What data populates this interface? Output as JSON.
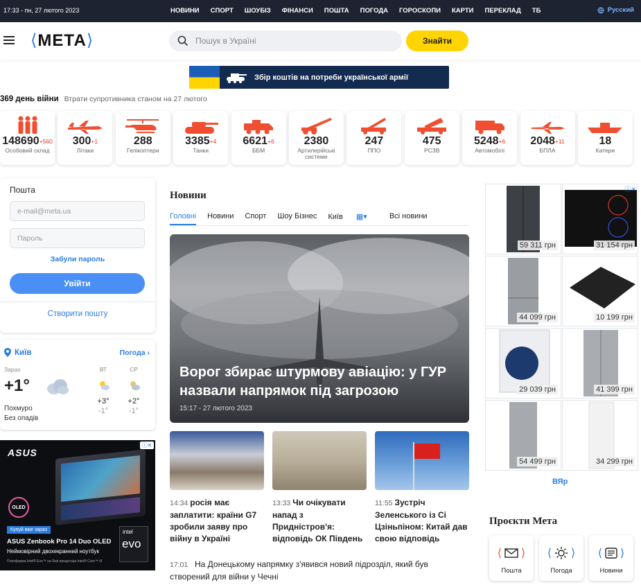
{
  "topbar": {
    "datetime": "17:33 - пн, 27 лютого 2023",
    "nav": [
      "НОВИНИ",
      "СПОРТ",
      "ШОУБІЗ",
      "ФІНАНСИ",
      "ПОШТА",
      "ПОГОДА",
      "ГОРОСКОПИ",
      "КАРТИ",
      "ПЕРЕКЛАД",
      "ТБ"
    ],
    "lang": "Русский"
  },
  "header": {
    "logo": "МЕТА",
    "search_placeholder": "Пошук в Україні",
    "find_label": "Знайти"
  },
  "banner": {
    "text": "Збір коштів на потреби української армії"
  },
  "war": {
    "day_label": "369 день війни",
    "losses_label": "Втрати супротивника станом на 27 лютого",
    "stats": [
      {
        "icon": "soldiers-icon",
        "value": "148690",
        "delta": "+560",
        "label": "Особовий склад"
      },
      {
        "icon": "plane-icon",
        "value": "300",
        "delta": "+1",
        "label": "Літаки"
      },
      {
        "icon": "helicopter-icon",
        "value": "288",
        "delta": "",
        "label": "Гелікоптери"
      },
      {
        "icon": "tank-icon",
        "value": "3385",
        "delta": "+4",
        "label": "Танки"
      },
      {
        "icon": "bmp-icon",
        "value": "6621",
        "delta": "+6",
        "label": "ББМ"
      },
      {
        "icon": "artillery-icon",
        "value": "2380",
        "delta": "",
        "label": "Артилерійські системи"
      },
      {
        "icon": "air-defense-icon",
        "value": "247",
        "delta": "",
        "label": "ППО"
      },
      {
        "icon": "mlrs-icon",
        "value": "475",
        "delta": "",
        "label": "РСЗВ"
      },
      {
        "icon": "truck-icon",
        "value": "5248",
        "delta": "+6",
        "label": "Автомобілі"
      },
      {
        "icon": "drone-icon",
        "value": "2048",
        "delta": "+11",
        "label": "БПЛА"
      },
      {
        "icon": "boat-icon",
        "value": "18",
        "delta": "",
        "label": "Катери"
      }
    ]
  },
  "login": {
    "title": "Пошта",
    "email_placeholder": "e-mail@meta.ua",
    "password_placeholder": "Пароль",
    "forgot": "Забули пароль",
    "submit": "Увійти",
    "create": "Створити пошту"
  },
  "weather": {
    "city": "Київ",
    "forecast_link": "Погода",
    "now_label": "Зараз",
    "now_temp": "+1°",
    "desc1": "Похмуро",
    "desc2": "Без опадів",
    "days": [
      {
        "name": "ВТ",
        "hi": "+3°",
        "lo": "-1°"
      },
      {
        "name": "СР",
        "hi": "+2°",
        "lo": "-1°"
      }
    ]
  },
  "asus_ad": {
    "brand": "ASUS",
    "badge": "Купуй вже зараз",
    "model": "ASUS Zenbook Pro 14 Duo OLED",
    "tagline": "Неймовірний двохекранний ноутбук",
    "platform": "Платформа Intel® Evo™ на базі процесора Intel® Core™ i9",
    "oled": "OLED",
    "intel": "intel",
    "evo": "evo"
  },
  "news": {
    "title": "Новини",
    "tabs": [
      "Головні",
      "Новини",
      "Спорт",
      "Шоу Бізнес",
      "Київ",
      "Всі новини"
    ],
    "hero": {
      "title": "Ворог збирає штурмову авіацію: у ГУР назвали напрямок під загрозою",
      "date": "15:17 - 27 лютого 2023"
    },
    "cards": [
      {
        "time": "14:34",
        "title": "росія має заплатити: країни G7 зробили заяву про війну в Україні"
      },
      {
        "time": "13:33",
        "title": "Чи очікувати напад з Придністров'я: відповідь ОК Південь"
      },
      {
        "time": "11:55",
        "title": "Зустріч Зеленського із Сі Цзіньпіном: Китай дав свою відповідь"
      }
    ],
    "line": {
      "time": "17:01",
      "title": "На Донецькому напрямку з'явився новий підрозділ, який був створений для війни у Чечні"
    }
  },
  "shop": {
    "prices": [
      "59 311 грн",
      "31 154 грн",
      "44 099 грн",
      "10 199 грн",
      "29 039 грн",
      "41 399 грн",
      "54 499 грн",
      "34 299 грн"
    ],
    "vyar": "ВЯр"
  },
  "projects": {
    "title": "Проєкти Мета",
    "items": [
      "Пошта",
      "Погода",
      "Новини"
    ]
  }
}
